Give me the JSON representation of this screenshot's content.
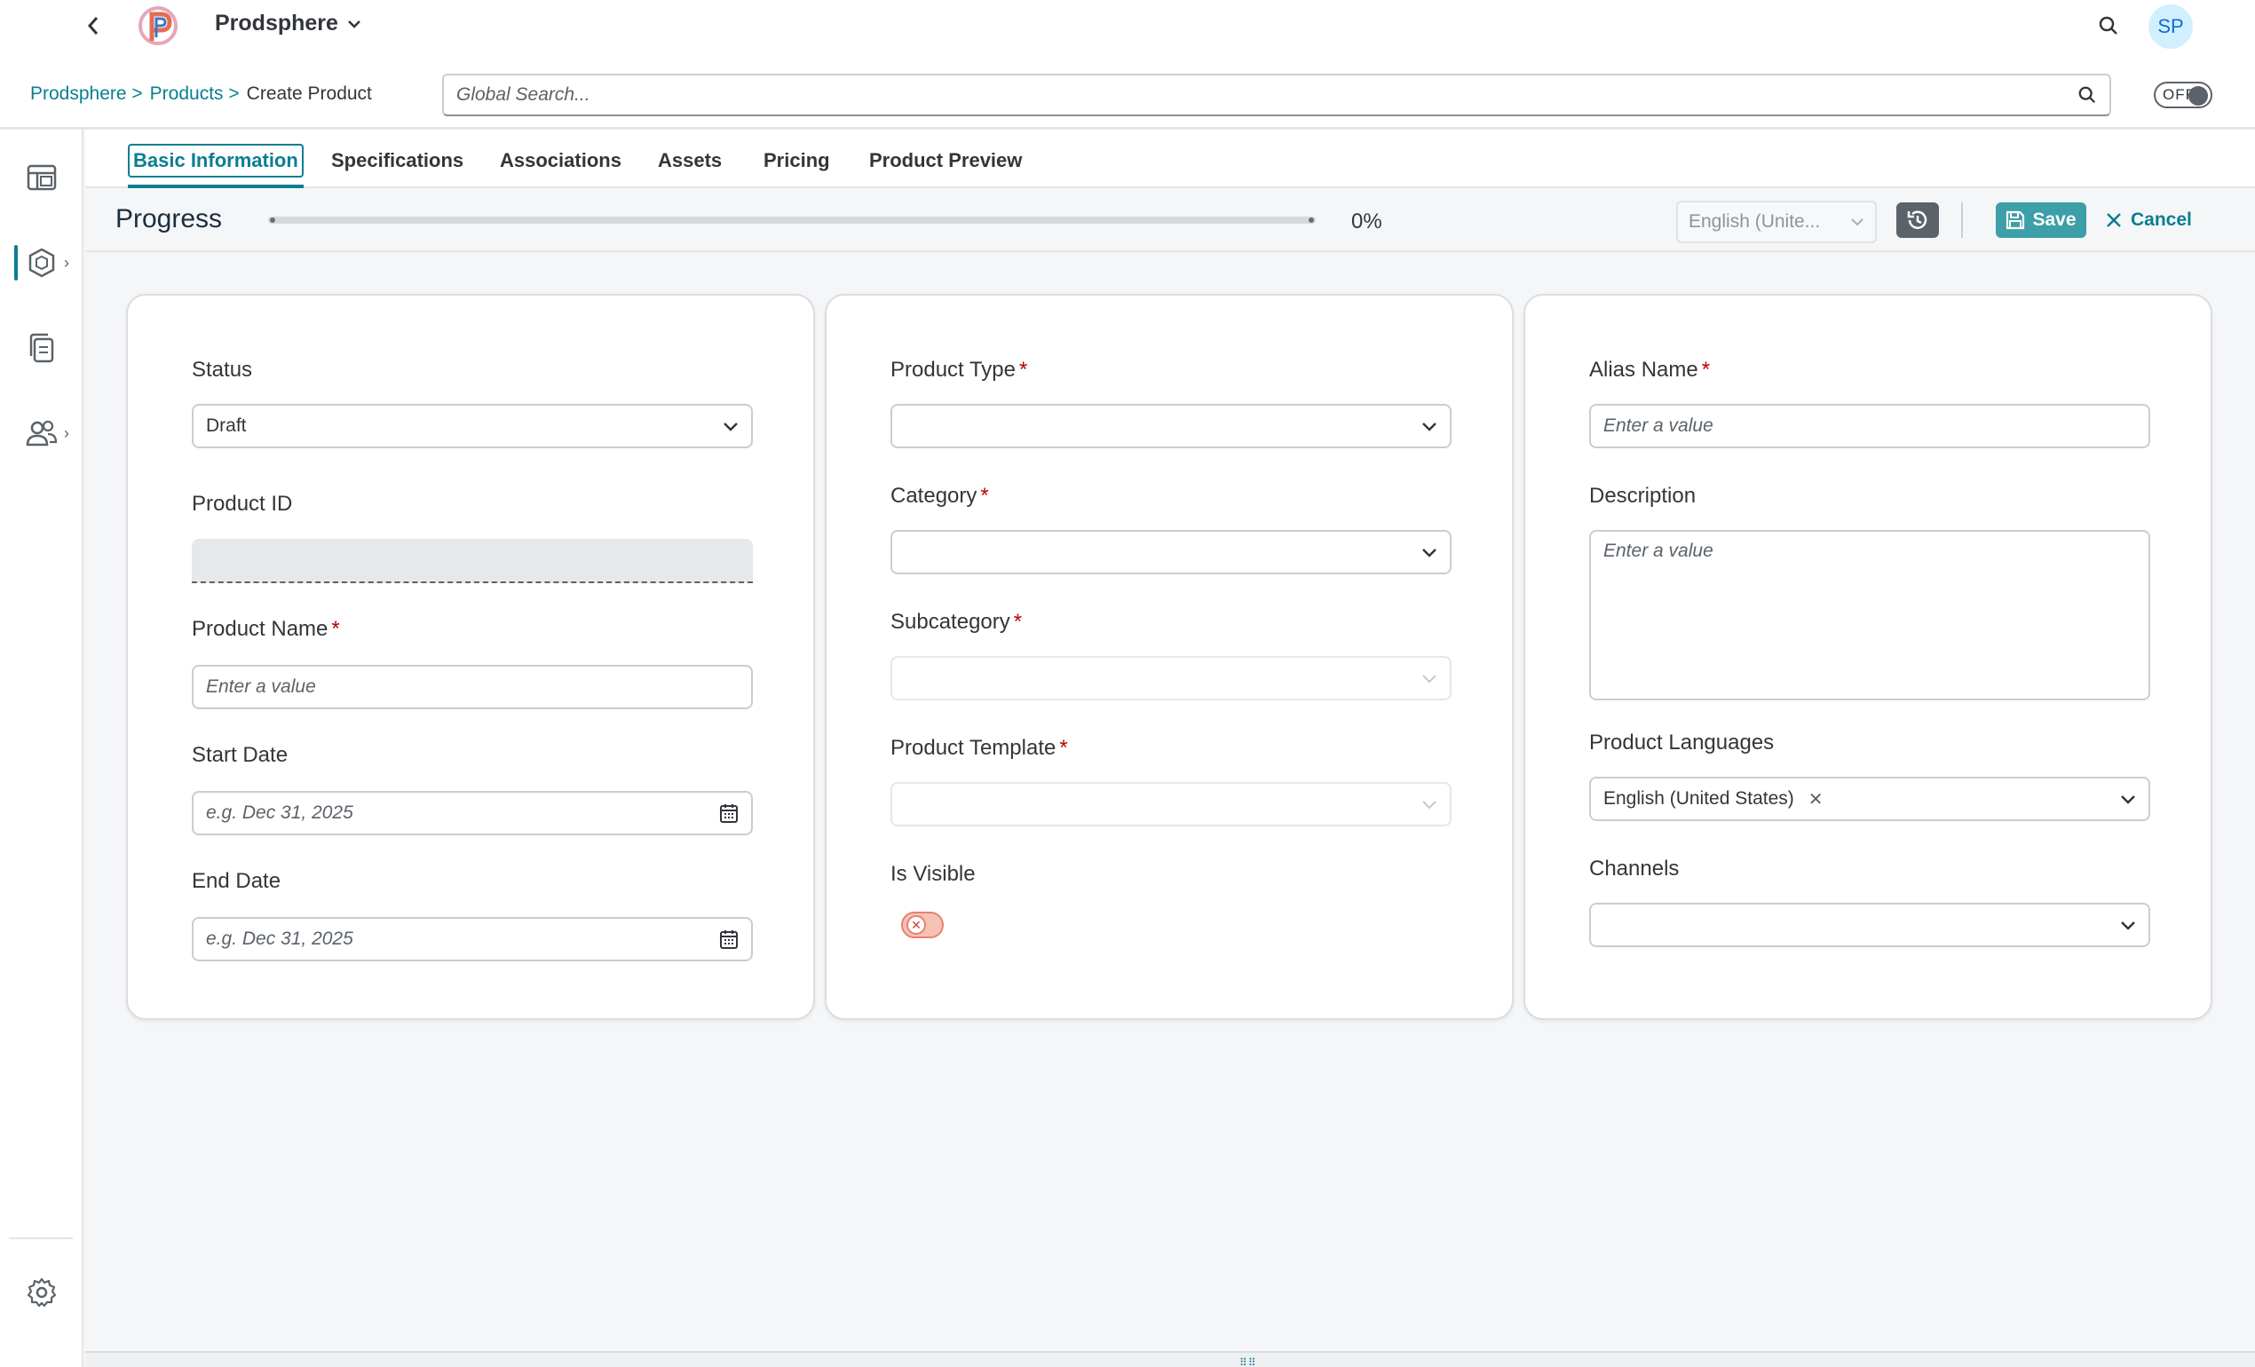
{
  "header": {
    "app_name": "Prodsphere",
    "avatar_initials": "SP",
    "breadcrumb": [
      "Prodsphere >",
      "Products >",
      "Create Product"
    ],
    "search_placeholder": "Global Search...",
    "toggle_label": "OFF"
  },
  "tabs": [
    "Basic Information",
    "Specifications",
    "Associations",
    "Assets",
    "Pricing",
    "Product Preview"
  ],
  "active_tab": "Basic Information",
  "progress": {
    "title": "Progress",
    "value_label": "0%",
    "fraction": 0,
    "language": "English (Unite...",
    "save_label": "Save",
    "cancel_label": "Cancel"
  },
  "card1": {
    "status_label": "Status",
    "status_value": "Draft",
    "product_id_label": "Product ID",
    "product_name_label": "Product Name",
    "product_name_placeholder": "Enter a value",
    "start_date_label": "Start Date",
    "start_date_placeholder": "e.g. Dec 31, 2025",
    "end_date_label": "End Date",
    "end_date_placeholder": "e.g. Dec 31, 2025"
  },
  "card2": {
    "product_type_label": "Product Type",
    "category_label": "Category",
    "subcategory_label": "Subcategory",
    "template_label": "Product Template",
    "is_visible_label": "Is Visible",
    "is_visible": false
  },
  "card3": {
    "alias_label": "Alias Name",
    "alias_placeholder": "Enter a value",
    "description_label": "Description",
    "description_placeholder": "Enter a value",
    "languages_label": "Product Languages",
    "language_token": "English (United States)",
    "channels_label": "Channels"
  },
  "required_marker": "*",
  "colors": {
    "accent": "#0a7e91",
    "required": "#bb0000",
    "save_button": "#3d9fa8",
    "toggle_off": "#e8816c"
  },
  "icons": {
    "back": "chevron-left-icon",
    "logo": "prodsphere-logo",
    "search": "search-icon",
    "nav": [
      "dashboard-icon",
      "products-icon",
      "documents-icon",
      "users-icon",
      "settings-icon"
    ],
    "history": "history-icon",
    "save": "floppy-disk-icon",
    "cancel": "close-icon",
    "calendar": "calendar-icon",
    "dropdown": "chevron-down-icon"
  }
}
